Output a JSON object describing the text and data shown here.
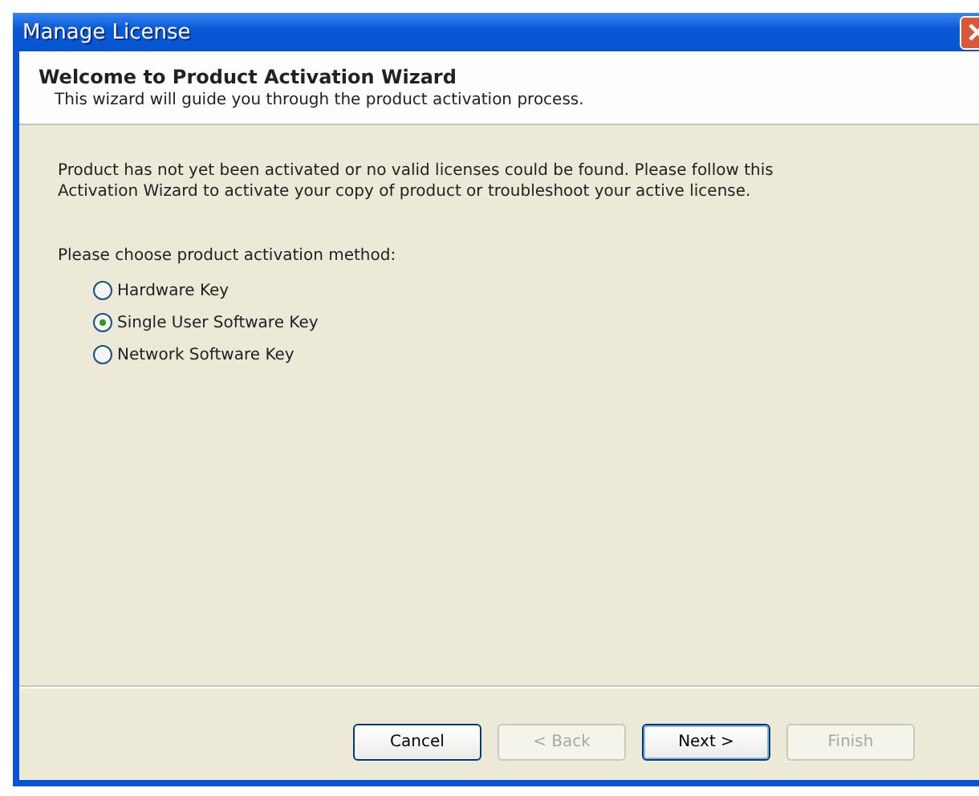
{
  "window": {
    "title": "Manage License"
  },
  "header": {
    "title": "Welcome to Product Activation Wizard",
    "subtitle": "This wizard will guide you through the product activation process."
  },
  "message": "Product has not yet been activated or no valid licenses could be found. Please follow this Activation Wizard to activate your copy of product or troubleshoot your active license.",
  "prompt": "Please choose product activation method:",
  "methods": [
    {
      "label": "Hardware Key",
      "selected": false
    },
    {
      "label": "Single User Software Key",
      "selected": true
    },
    {
      "label": "Network Software Key",
      "selected": false
    }
  ],
  "buttons": [
    {
      "label": "Cancel",
      "disabled": false,
      "default": false
    },
    {
      "label": "< Back",
      "disabled": true,
      "default": false
    },
    {
      "label": "Next >",
      "disabled": false,
      "default": true
    },
    {
      "label": "Finish",
      "disabled": true,
      "default": false
    }
  ]
}
